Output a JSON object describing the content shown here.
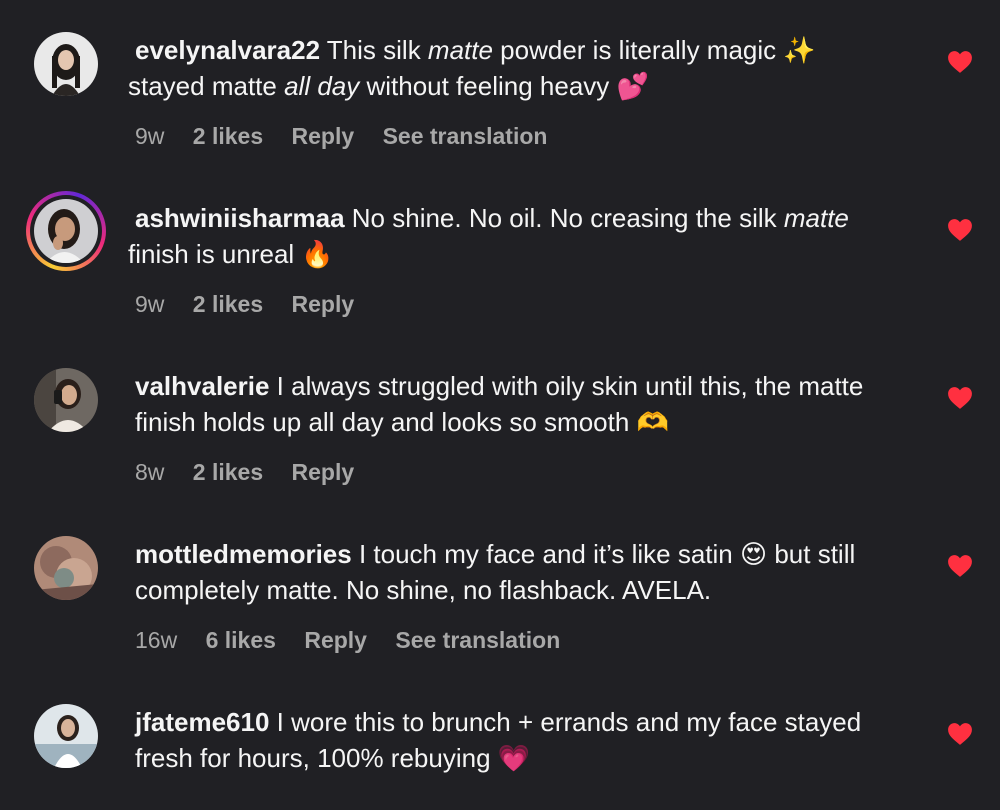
{
  "comments": [
    {
      "username": "evelynalvara22",
      "segments": [
        {
          "t": " This silk ",
          "i": false
        },
        {
          "t": "matte",
          "i": true
        },
        {
          "t": " powder is literally magic ✨",
          "i": false
        },
        {
          "t": " stayed matte ",
          "i": false
        },
        {
          "t": "all day",
          "i": true
        },
        {
          "t": " without feeling heavy 💕",
          "i": false
        }
      ],
      "time": "9w",
      "likes": "2 likes",
      "reply": "Reply",
      "translation": "See translation",
      "liked": true
    },
    {
      "username": "ashwiniisharmaa",
      "segments": [
        {
          "t": " No shine. No oil. No creasing the silk ",
          "i": false
        },
        {
          "t": "matte",
          "i": true
        },
        {
          "t": " finish is unreal 🔥",
          "i": false
        }
      ],
      "time": "9w",
      "likes": "2 likes",
      "reply": "Reply",
      "translation": "",
      "liked": true
    },
    {
      "username": "valhvalerie",
      "segments": [
        {
          "t": " I always struggled with oily skin until this, the matte finish holds up all day and looks so smooth 🫶",
          "i": false
        }
      ],
      "time": "8w",
      "likes": "2 likes",
      "reply": "Reply",
      "translation": "",
      "liked": true
    },
    {
      "username": "mottledmemories",
      "segments": [
        {
          "t": " I touch my face and it’s like satin 😍 but still completely matte. No shine, no flashback. AVELA.",
          "i": false
        }
      ],
      "time": "16w",
      "likes": "6 likes",
      "reply": "Reply",
      "translation": "See translation",
      "liked": true
    },
    {
      "username": "jfateme610",
      "segments": [
        {
          "t": " I wore this to brunch + errands and my face stayed fresh for hours, 100% rebuying 💗",
          "i": false
        }
      ],
      "time": "",
      "likes": "",
      "reply": "",
      "translation": "",
      "liked": true
    }
  ],
  "colors": {
    "background": "#202024",
    "text": "#f5f5f5",
    "meta": "#a8a8a8",
    "heart": "#ff3040"
  },
  "icons": {
    "like": "heart-filled-icon"
  }
}
